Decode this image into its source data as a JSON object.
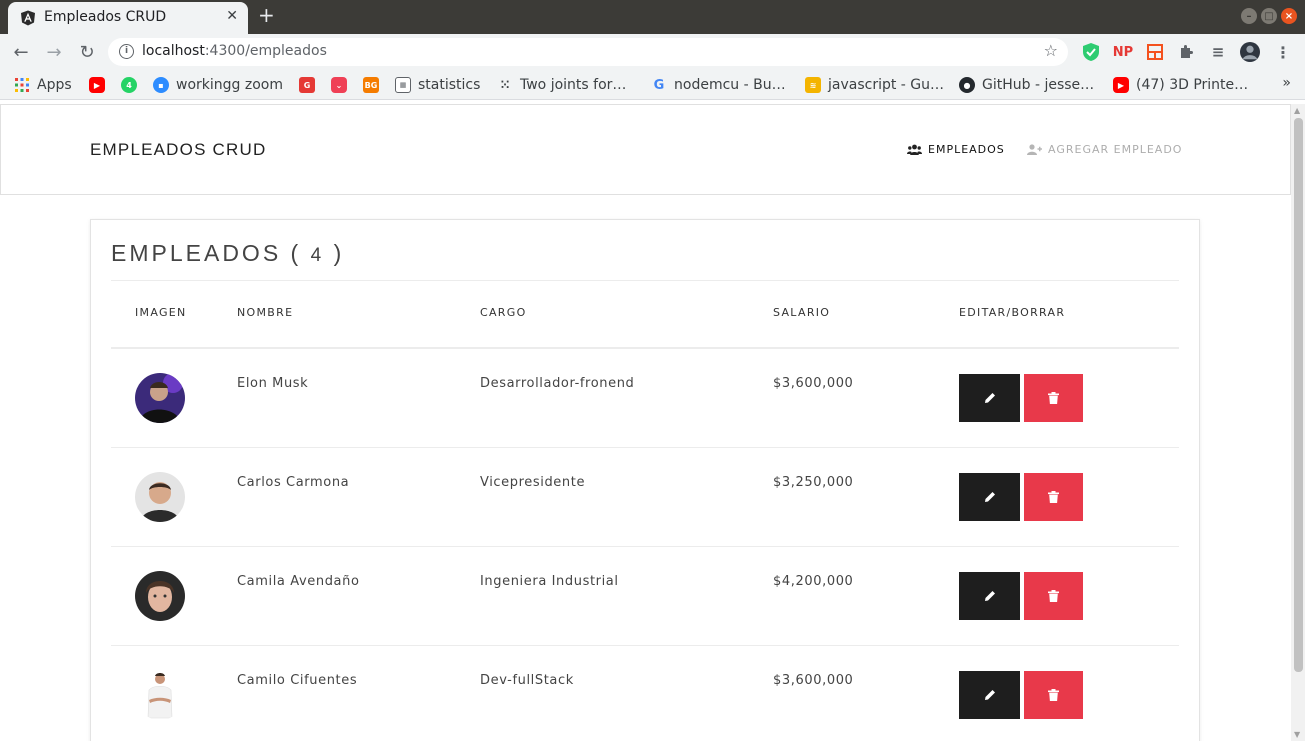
{
  "browser": {
    "tab_title": "Empleados CRUD",
    "tab_close": "✕",
    "new_tab": "+",
    "url_host": "localhost",
    "url_rest": ":4300/empleados",
    "bookmarks": [
      {
        "label": "Apps",
        "icon": "apps-grid-icon",
        "color": "#4285f4"
      },
      {
        "label": "",
        "icon": "youtube-icon",
        "color": "#ff0000"
      },
      {
        "label": "",
        "icon": "whatsapp-icon",
        "color": "#25d366"
      },
      {
        "label": "workingg zoom",
        "icon": "zoom-icon",
        "color": "#2d8cff"
      },
      {
        "label": "",
        "icon": "red-app-icon",
        "color": "#e53935"
      },
      {
        "label": "",
        "icon": "pocket-icon",
        "color": "#ef4056"
      },
      {
        "label": "",
        "icon": "bg-icon",
        "color": "#f57c00"
      },
      {
        "label": "statistics",
        "icon": "calculator-icon",
        "color": "#5f6368"
      },
      {
        "label": "Two joints for…",
        "icon": "dots-grid-icon",
        "color": "#3c4043"
      },
      {
        "label": "nodemcu - Bu…",
        "icon": "google-icon",
        "color": "#4285f4"
      },
      {
        "label": "javascript - Gu…",
        "icon": "stackoverflow-icon",
        "color": "#f48024"
      },
      {
        "label": "GitHub - jesse…",
        "icon": "github-icon",
        "color": "#24292e"
      },
      {
        "label": "(47) 3D Printe…",
        "icon": "youtube-icon",
        "color": "#ff0000"
      }
    ],
    "bookmarks_more": "»"
  },
  "app": {
    "brand": "EMPLEADOS CRUD",
    "nav": {
      "empleados": "EMPLEADOS",
      "agregar": "AGREGAR EMPLEADO"
    },
    "section_title": "EMPLEADOS (",
    "count": "4",
    "section_title_close": ")",
    "headers": {
      "imagen": "IMAGEN",
      "nombre": "NOMBRE",
      "cargo": "CARGO",
      "salario": "SALARIO",
      "acciones": "EDITAR/BORRAR"
    },
    "employees": [
      {
        "nombre": "Elon Musk",
        "cargo": "Desarrollador-fronend",
        "salario": "$3,600,000"
      },
      {
        "nombre": "Carlos Carmona",
        "cargo": "Vicepresidente",
        "salario": "$3,250,000"
      },
      {
        "nombre": "Camila Avendaño",
        "cargo": "Ingeniera Industrial",
        "salario": "$4,200,000"
      },
      {
        "nombre": "Camilo Cifuentes",
        "cargo": "Dev-fullStack",
        "salario": "$3,600,000"
      }
    ]
  },
  "colors": {
    "edit_button": "#1e1e1e",
    "delete_button": "#e8394a",
    "nav_inactive": "#adadad"
  }
}
